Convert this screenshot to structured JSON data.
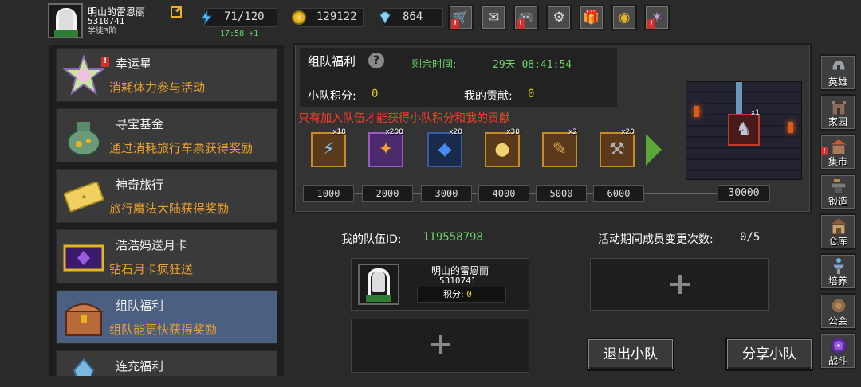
{
  "player": {
    "name": "明山的雷恩丽",
    "id": "5310741",
    "subtitle": "学徒3阶"
  },
  "resources": {
    "energy": "71/120",
    "energy_timer": "17:58 +1",
    "coins": "129122",
    "gems": "864"
  },
  "top_menu": [
    {
      "name": "shop",
      "icon": "🛒",
      "alert": "!"
    },
    {
      "name": "mail",
      "icon": "✉",
      "alert": ""
    },
    {
      "name": "controller",
      "icon": "🎮",
      "alert": "!"
    },
    {
      "name": "settings",
      "icon": "⚙",
      "alert": ""
    },
    {
      "name": "gift",
      "icon": "🎁",
      "alert": ""
    },
    {
      "name": "wheel",
      "icon": "◉",
      "alert": ""
    },
    {
      "name": "fireworks",
      "icon": "✶",
      "alert": "!"
    }
  ],
  "events": [
    {
      "title": "幸运星",
      "desc": "消耗体力参与活动",
      "icon": "star",
      "alert": "!"
    },
    {
      "title": "寻宝基金",
      "desc": "通过消耗旅行车票获得奖励",
      "icon": "bag",
      "alert": ""
    },
    {
      "title": "神奇旅行",
      "desc": "旅行魔法大陆获得奖励",
      "icon": "ticket",
      "alert": ""
    },
    {
      "title": "浩浩妈送月卡",
      "desc": "钻石月卡疯狂送",
      "icon": "card",
      "alert": ""
    },
    {
      "title": "组队福利",
      "desc": "组队能更快获得奖励",
      "icon": "chest",
      "alert": ""
    },
    {
      "title": "连充福利",
      "desc": "",
      "icon": "crystal",
      "alert": ""
    }
  ],
  "panel": {
    "title": "组队福利",
    "help": "?",
    "remain_label": "剩余时间:",
    "remain_value": "29天 08:41:54",
    "score_label": "小队积分:",
    "score_value": "0",
    "contrib_label": "我的贡献:",
    "contrib_value": "0",
    "notice": "只有加入队伍才能获得小队积分和我的贡献",
    "rewards": [
      {
        "qty": "x10",
        "glyph": "⚡",
        "color": "#7ac8f0",
        "style": "normal"
      },
      {
        "qty": "x200",
        "glyph": "✦",
        "color": "#f0a030",
        "style": "rare"
      },
      {
        "qty": "x20",
        "glyph": "◆",
        "color": "#4a8af0",
        "style": "blue"
      },
      {
        "qty": "x30",
        "glyph": "●",
        "color": "#f0d070",
        "style": "normal"
      },
      {
        "qty": "x2",
        "glyph": "✎",
        "color": "#d8a050",
        "style": "normal"
      },
      {
        "qty": "x20",
        "glyph": "⚒",
        "color": "#b0b0b0",
        "style": "normal"
      }
    ],
    "thresholds": [
      "1000",
      "2000",
      "3000",
      "4000",
      "5000",
      "6000",
      "30000"
    ],
    "final_reward_qty": "x1",
    "final_reward_glyph": "♞"
  },
  "team": {
    "id_label": "我的队伍ID:",
    "id_value": "119558798",
    "changes_label": "活动期间成员变更次数:",
    "changes_value": "0/5",
    "member": {
      "name": "明山的雷恩丽",
      "id": "5310741",
      "score_label": "积分:",
      "score_value": "0"
    },
    "leave_label": "退出小队",
    "share_label": "分享小队"
  },
  "sidebar": [
    {
      "label": "英雄",
      "icon": "helmet",
      "alert": ""
    },
    {
      "label": "家园",
      "icon": "castle",
      "alert": ""
    },
    {
      "label": "集市",
      "icon": "market",
      "alert": "!"
    },
    {
      "label": "锻造",
      "icon": "anvil",
      "alert": ""
    },
    {
      "label": "仓库",
      "icon": "house",
      "alert": ""
    },
    {
      "label": "培养",
      "icon": "fountain",
      "alert": ""
    },
    {
      "label": "公会",
      "icon": "guild",
      "alert": ""
    },
    {
      "label": "战斗",
      "icon": "portal",
      "alert": ""
    }
  ],
  "colors": {
    "accent_green": "#6bd46b",
    "accent_orange": "#e8a030",
    "accent_gold": "#e6c422",
    "alert_red": "#d32f2f",
    "selected_blue": "#4b5f80"
  }
}
